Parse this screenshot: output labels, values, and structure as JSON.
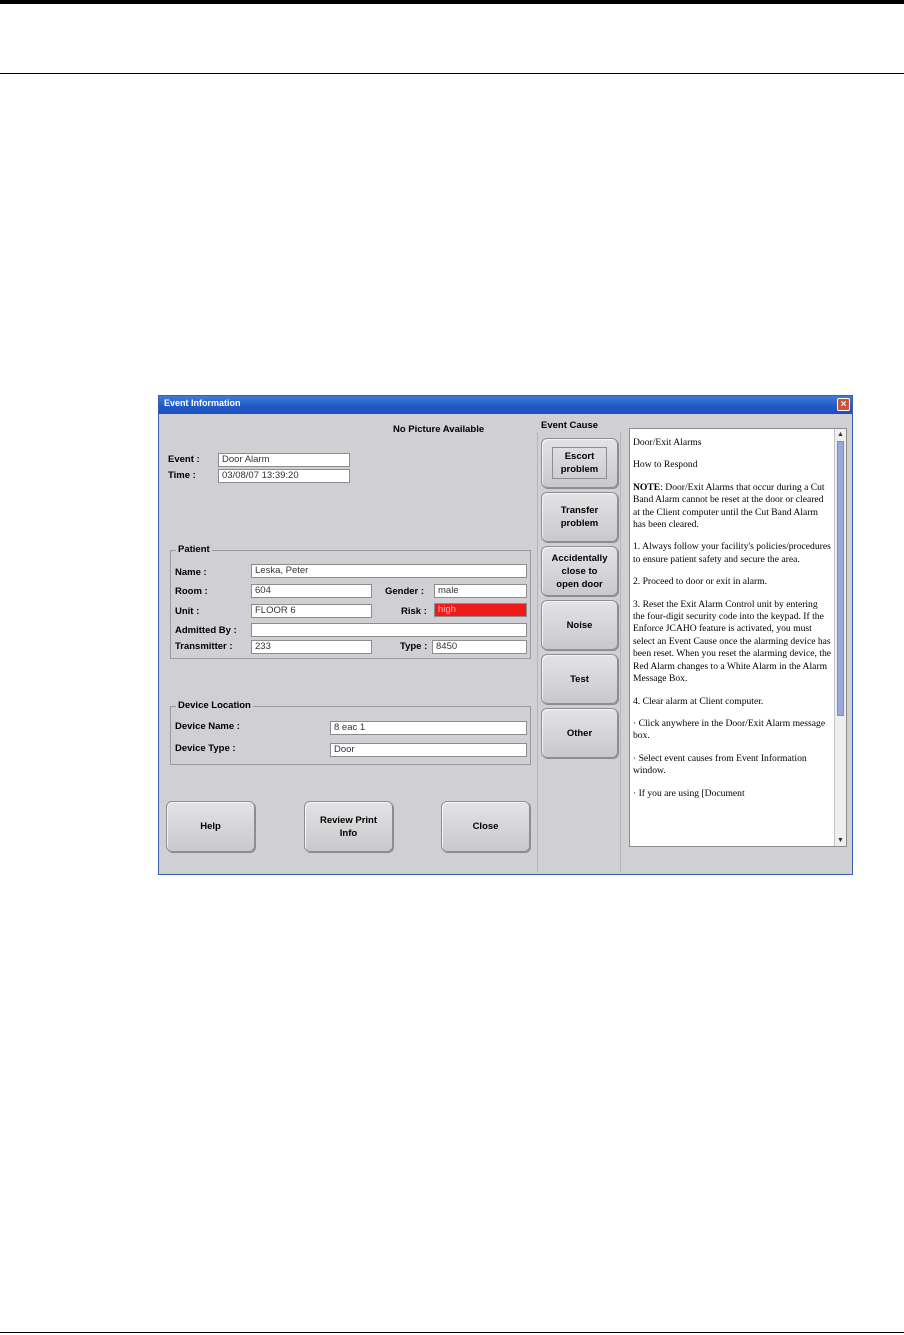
{
  "window": {
    "title": "Event Information",
    "close_glyph": "×"
  },
  "picture_status": "No Picture Available",
  "event": {
    "event_label": "Event :",
    "event_value": "Door Alarm",
    "time_label": "Time :",
    "time_value": "03/08/07 13:39:20"
  },
  "patient": {
    "group_title": "Patient",
    "name_label": "Name :",
    "name_value": "Leska, Peter",
    "room_label": "Room :",
    "room_value": "604",
    "gender_label": "Gender :",
    "gender_value": "male",
    "unit_label": "Unit :",
    "unit_value": "FLOOR 6",
    "risk_label": "Risk :",
    "risk_value": "high",
    "admitted_label": "Admitted By :",
    "admitted_value": "",
    "transmitter_label": "Transmitter :",
    "transmitter_value": "233",
    "type_label": "Type :",
    "type_value": "8450"
  },
  "device": {
    "group_title": "Device Location",
    "name_label": "Device Name :",
    "name_value": "8 eac 1",
    "type_label": "Device Type :",
    "type_value": "Door"
  },
  "buttons": {
    "help": "Help",
    "review": "Review Print\nInfo",
    "close": "Close"
  },
  "event_cause": {
    "title": "Event Cause",
    "causes": [
      "Escort\nproblem",
      "Transfer\nproblem",
      "Accidentally\nclose to\nopen door",
      "Noise",
      "Test",
      "Other"
    ]
  },
  "help_text": {
    "p1": "Door/Exit Alarms",
    "p2": "How to Respond",
    "p3_bold": "NOTE",
    "p3": ": Door/Exit Alarms that occur during a Cut Band Alarm cannot be reset at the door or cleared at the Client computer until the Cut Band Alarm has been cleared.",
    "p4": "1. Always follow your facility's policies/procedures to ensure patient safety and secure the area.",
    "p5": "2. Proceed to door or exit in alarm.",
    "p6": "3. Reset the Exit Alarm Control unit by entering the four-digit security code into the keypad. If the Enforce JCAHO feature is activated, you must select an Event Cause once the alarming device has been reset. When you reset the alarming device, the Red Alarm changes to a White Alarm in the Alarm Message Box.",
    "p7": "4. Clear alarm at Client computer.",
    "p8": "· Click anywhere in the Door/Exit Alarm message box.",
    "p9": "· Select event causes from Event Information window.",
    "p10": "· If you are using [Document"
  },
  "scroll_icons": {
    "up": "up-arrow-icon",
    "down": "down-arrow-icon"
  },
  "colors": {
    "titlebar": "#1f58c8",
    "risk_high": "#ef1a1a",
    "dialog_bg": "#cfcfd4"
  }
}
